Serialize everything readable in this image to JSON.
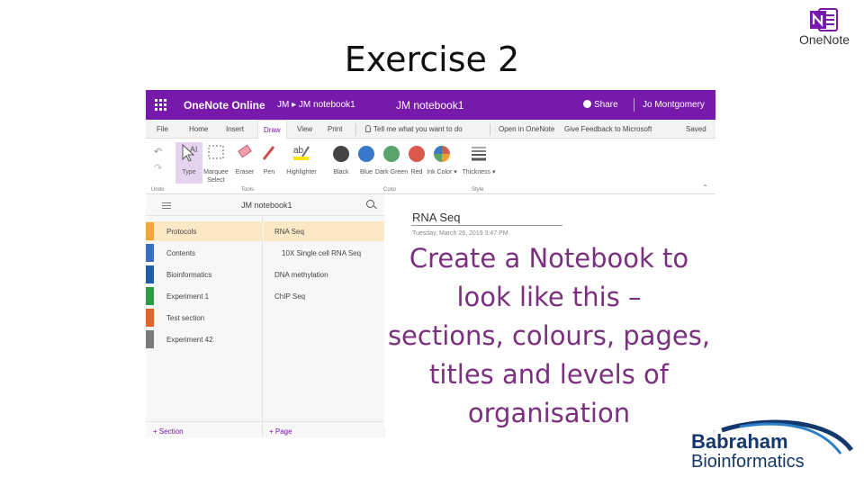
{
  "slide": {
    "title": "Exercise 2"
  },
  "logos": {
    "onenote": "OneNote",
    "babraham": "Babraham",
    "bioinformatics": "Bioinformatics"
  },
  "colors": {
    "onenote_purple": "#7719aa",
    "callout_text": "#7b2f7f",
    "babraham_navy": "#14386b"
  },
  "app": {
    "name": "OneNote Online",
    "breadcrumb": "JM ▸ JM notebook1",
    "notebook_title": "JM notebook1",
    "share": "Share",
    "user": "Jo Montgomery"
  },
  "menu": {
    "items": [
      "File",
      "Home",
      "Insert",
      "Draw",
      "View",
      "Print"
    ],
    "active": "Draw",
    "tell_me": "Tell me what you want to do",
    "open_in": "Open in OneNote",
    "feedback": "Give Feedback to Microsoft",
    "status": "Saved"
  },
  "ribbon": {
    "tools": [
      "Type",
      "Marquee Select",
      "Eraser",
      "Pen",
      "Highlighter"
    ],
    "colors": [
      {
        "label": "Black",
        "hex": "#444444"
      },
      {
        "label": "Blue",
        "hex": "#3a78c9"
      },
      {
        "label": "Dark Green",
        "hex": "#5aa36b"
      },
      {
        "label": "Red",
        "hex": "#d9594c"
      },
      {
        "label": "Ink Color ▾",
        "hex": "#f0a030"
      }
    ],
    "thickness": "Thickness ▾",
    "groups": [
      "Undo",
      "Tools",
      "Color",
      "Style"
    ]
  },
  "nav": {
    "notebook": "JM notebook1",
    "sections": [
      {
        "label": "Protocols",
        "color": "#f0a830"
      },
      {
        "label": "Contents",
        "color": "#3a6fc4"
      },
      {
        "label": "Bioinformatics",
        "color": "#1f5fa8"
      },
      {
        "label": "Experiment 1",
        "color": "#2e9a45"
      },
      {
        "label": "Test section",
        "color": "#e8632b"
      },
      {
        "label": "Experiment 42",
        "color": "#7a7a7a"
      }
    ],
    "pages": [
      {
        "label": "RNA Seq",
        "sub": false
      },
      {
        "label": "10X Single cell RNA Seq",
        "sub": true
      },
      {
        "label": "DNA methylation",
        "sub": false
      },
      {
        "label": "ChIP Seq",
        "sub": false
      }
    ],
    "add_section": "+ Section",
    "add_page": "+ Page"
  },
  "page": {
    "title": "RNA Seq",
    "date": "Tuesday, March 26, 2019     3:47 PM"
  },
  "callout": {
    "lines": [
      "Create a Notebook to",
      "look like this –",
      "sections, colours, pages,",
      "titles and levels of",
      "organisation"
    ]
  }
}
